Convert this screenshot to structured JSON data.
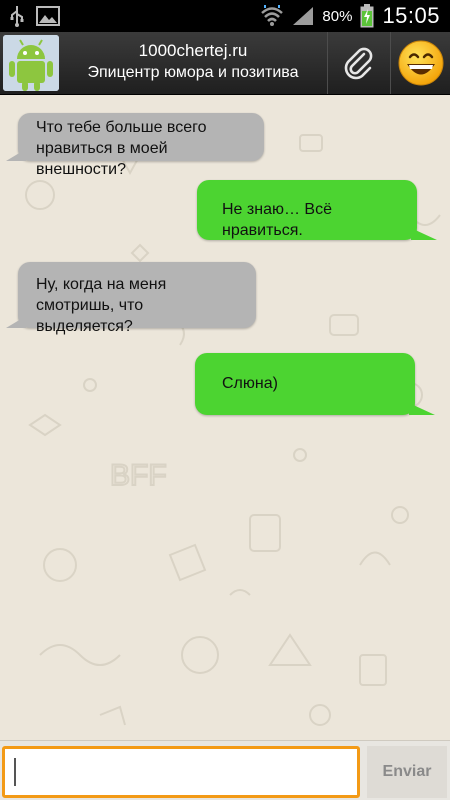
{
  "status_bar": {
    "icons": [
      "usb-icon",
      "gallery-icon",
      "wifi-icon",
      "signal-icon",
      "battery-charging-icon"
    ],
    "battery_percent": "80%",
    "time": "15:05"
  },
  "header": {
    "title": "1000chertej.ru",
    "subtitle": "Эпицентр юмора и позитива",
    "avatar_icon": "android-robot-icon",
    "attach_icon": "paperclip-icon",
    "emoji_icon": "smiley-emoji-icon"
  },
  "colors": {
    "incoming_bubble": "#b4b4b4",
    "outgoing_bubble": "#4cd431",
    "input_border": "#f39a16"
  },
  "messages": [
    {
      "direction": "incoming",
      "text": "Что тебе больше всего нравиться в моей внешности?"
    },
    {
      "direction": "outgoing",
      "text": "Не знаю… Всё нравиться."
    },
    {
      "direction": "incoming",
      "text": "Ну, когда на меня смотришь, что выделяется?"
    },
    {
      "direction": "outgoing",
      "text": "Слюна)"
    }
  ],
  "input": {
    "value": "",
    "placeholder": "",
    "send_label": "Enviar"
  }
}
